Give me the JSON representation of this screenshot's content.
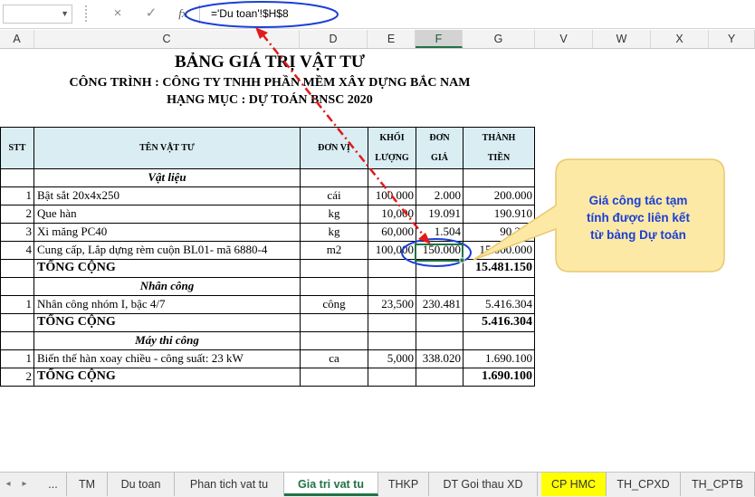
{
  "formula_bar": {
    "name_box": "",
    "cancel_icon": "×",
    "enter_icon": "✓",
    "fx_label": "fx",
    "formula": "='Du toan'!$H$8"
  },
  "columns": [
    "A",
    "C",
    "D",
    "E",
    "F",
    "G",
    "V",
    "W",
    "X",
    "Y"
  ],
  "selected_column": "F",
  "sheet": {
    "title": "BẢNG GIÁ TRỊ VẬT TƯ",
    "project": "CÔNG TRÌNH : CÔNG TY TNHH PHẦN MỀM XÂY DỰNG BẮC NAM",
    "category": "HẠNG MỤC : DỰ TOÁN BNSC 2020",
    "headers": {
      "stt": "STT",
      "name": "TÊN VẬT TƯ",
      "unit": "ĐƠN VỊ",
      "qty": "KHỐI LƯỢNG",
      "price": "ĐƠN GIÁ",
      "amount": "THÀNH TIỀN"
    },
    "rows": [
      {
        "type": "section",
        "name": "Vật liệu"
      },
      {
        "type": "item",
        "stt": "1",
        "name": "Bật sắt 20x4x250",
        "unit": "cái",
        "qty": "100,000",
        "price": "2.000",
        "amount": "200.000"
      },
      {
        "type": "item",
        "stt": "2",
        "name": "Que hàn",
        "unit": "kg",
        "qty": "10,000",
        "price": "19.091",
        "amount": "190.910"
      },
      {
        "type": "item",
        "stt": "3",
        "name": "Xi măng PC40",
        "unit": "kg",
        "qty": "60,000",
        "price": "1.504",
        "amount": "90.240"
      },
      {
        "type": "item",
        "stt": "4",
        "name": "Cung cấp, Lắp dựng rèm cuộn BL01- mã 6880-4",
        "unit": "m2",
        "qty": "100,000",
        "price": "150.000",
        "amount": "15.000.000"
      },
      {
        "type": "total",
        "stt": "",
        "name": "TỔNG CỘNG",
        "amount": "15.481.150"
      },
      {
        "type": "section",
        "name": "Nhân công"
      },
      {
        "type": "item",
        "stt": "1",
        "name": "Nhân công nhóm I, bậc 4/7",
        "unit": "công",
        "qty": "23,500",
        "price": "230.481",
        "amount": "5.416.304"
      },
      {
        "type": "total",
        "stt": "",
        "name": "TỔNG CỘNG",
        "amount": "5.416.304"
      },
      {
        "type": "section",
        "name": "Máy thi công"
      },
      {
        "type": "item",
        "stt": "1",
        "name": "Biến thế hàn xoay chiều - công suất: 23 kW",
        "unit": "ca",
        "qty": "5,000",
        "price": "338.020",
        "amount": "1.690.100"
      },
      {
        "type": "total",
        "stt": "2",
        "name": "TỔNG CỘNG",
        "amount": "1.690.100"
      }
    ]
  },
  "callout": {
    "text_lines": [
      "Giá công tác tạm",
      "tính được liên kết",
      "từ bảng Dự toán"
    ],
    "bg_color": "#fde9a6",
    "text_color": "#1a3fd6"
  },
  "sheet_tabs": {
    "nav_prev": "◂",
    "nav_next": "▸",
    "more": "...",
    "tabs": [
      {
        "label": "TM",
        "active": false,
        "color": ""
      },
      {
        "label": "Du toan",
        "active": false,
        "color": ""
      },
      {
        "label": "Phan tich vat tu",
        "active": false,
        "color": ""
      },
      {
        "label": "Gia tri vat tu",
        "active": true,
        "color": ""
      },
      {
        "label": "THKP",
        "active": false,
        "color": ""
      },
      {
        "label": "DT Goi thau XD",
        "active": false,
        "color": ""
      },
      {
        "label": "CP HMC",
        "active": false,
        "color": "#ffff00"
      },
      {
        "label": "TH_CPXD",
        "active": false,
        "color": ""
      },
      {
        "label": "TH_CPTB",
        "active": false,
        "color": ""
      }
    ]
  },
  "colors": {
    "header_fill": "#d9edf3",
    "accent": "#217346",
    "arrow": "#e01b1b",
    "highlight_ellipse": "#1a3fd6"
  }
}
